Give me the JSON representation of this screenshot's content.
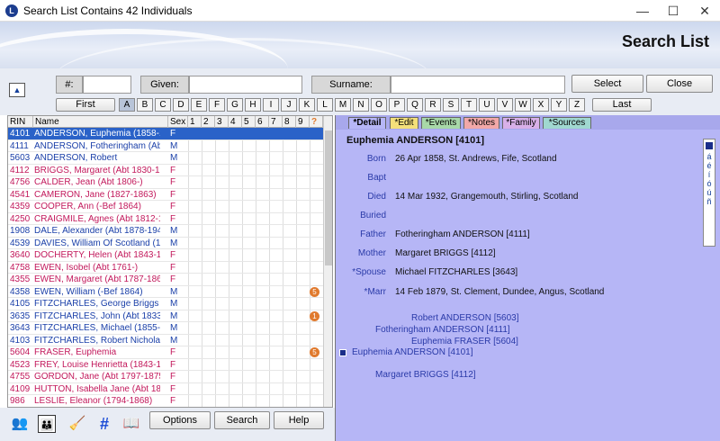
{
  "window": {
    "title": "Search List Contains 42 Individuals",
    "app_icon": "L"
  },
  "banner": {
    "title": "Search List"
  },
  "search": {
    "num_label": "#:",
    "given_label": "Given:",
    "surname_label": "Surname:",
    "select_label": "Select",
    "close_label": "Close",
    "first_label": "First",
    "last_label": "Last",
    "up_glyph": "▲"
  },
  "letters": [
    "A",
    "B",
    "C",
    "D",
    "E",
    "F",
    "G",
    "H",
    "I",
    "J",
    "K",
    "L",
    "M",
    "N",
    "O",
    "P",
    "Q",
    "R",
    "S",
    "T",
    "U",
    "V",
    "W",
    "X",
    "Y",
    "Z"
  ],
  "list": {
    "headers": {
      "rin": "RIN",
      "name": "Name",
      "sex": "Sex",
      "cols": [
        "1",
        "2",
        "3",
        "4",
        "5",
        "6",
        "7",
        "8",
        "9"
      ],
      "q": "?"
    },
    "rows": [
      {
        "rin": "4101",
        "name": "ANDERSON, Euphemia (1858-1",
        "sex": "F",
        "sel": true
      },
      {
        "rin": "4111",
        "name": "ANDERSON, Fotheringham (Ab",
        "sex": "M"
      },
      {
        "rin": "5603",
        "name": "ANDERSON, Robert",
        "sex": "M"
      },
      {
        "rin": "4112",
        "name": "BRIGGS, Margaret (Abt 1830-1",
        "sex": "F"
      },
      {
        "rin": "4756",
        "name": "CALDER, Jean (Abt 1806-)",
        "sex": "F"
      },
      {
        "rin": "4541",
        "name": "CAMERON, Jane (1827-1863)",
        "sex": "F"
      },
      {
        "rin": "4359",
        "name": "COOPER, Ann (-Bef 1864)",
        "sex": "F"
      },
      {
        "rin": "4250",
        "name": "CRAIGMILE, Agnes (Abt 1812-1",
        "sex": "F"
      },
      {
        "rin": "1908",
        "name": "DALE, Alexander (Abt 1878-194",
        "sex": "M"
      },
      {
        "rin": "4539",
        "name": "DAVIES, William Of Scotland (1",
        "sex": "M"
      },
      {
        "rin": "3640",
        "name": "DOCHERTY, Helen (Abt 1843-1",
        "sex": "F"
      },
      {
        "rin": "4758",
        "name": "EWEN, Isobel (Abt 1761-)",
        "sex": "F"
      },
      {
        "rin": "4355",
        "name": "EWEN, Margaret (Abt 1787-186",
        "sex": "F"
      },
      {
        "rin": "4358",
        "name": "EWEN, William (-Bef 1864)",
        "sex": "M",
        "badge": "5"
      },
      {
        "rin": "4105",
        "name": "FITZCHARLES, George Briggs",
        "sex": "M"
      },
      {
        "rin": "3635",
        "name": "FITZCHARLES, John (Abt 1833",
        "sex": "M",
        "badge": "1"
      },
      {
        "rin": "3643",
        "name": "FITZCHARLES, Michael (1855-1",
        "sex": "M"
      },
      {
        "rin": "4103",
        "name": "FITZCHARLES, Robert Nicholas",
        "sex": "M"
      },
      {
        "rin": "5604",
        "name": "FRASER, Euphemia",
        "sex": "F",
        "badge": "5"
      },
      {
        "rin": "4523",
        "name": "FREY, Louise Henrietta (1843-1",
        "sex": "F"
      },
      {
        "rin": "4755",
        "name": "GORDON, Jane (Abt 1797-1875",
        "sex": "F"
      },
      {
        "rin": "4109",
        "name": "HUTTON, Isabella Jane (Abt 186",
        "sex": "F"
      },
      {
        "rin": "986",
        "name": "LESLIE, Eleanor (1794-1868)",
        "sex": "F"
      }
    ]
  },
  "bottom": {
    "options_label": "Options",
    "search_label": "Search",
    "help_label": "Help"
  },
  "tabs": [
    "*Detail",
    "*Edit",
    "*Events",
    "*Notes",
    "*Family",
    "*Sources"
  ],
  "detail": {
    "heading": "Euphemia ANDERSON [4101]",
    "fields": [
      {
        "label": "Born",
        "value": "26 Apr 1858, St. Andrews, Fife, Scotland"
      },
      {
        "label": "Bapt",
        "value": ""
      },
      {
        "label": "Died",
        "value": "14 Mar 1932, Grangemouth, Stirling, Scotland"
      },
      {
        "label": "Buried",
        "value": ""
      },
      {
        "label": "Father",
        "value": "Fotheringham ANDERSON [4111]"
      },
      {
        "label": "Mother",
        "value": "Margaret BRIGGS [4112]"
      },
      {
        "label": "*Spouse",
        "value": "Michael FITZCHARLES [3643]"
      },
      {
        "label": "*Marr",
        "value": "14 Feb 1879, St. Clement, Dundee, Angus, Scotland"
      }
    ],
    "family": [
      "Robert ANDERSON [5603]",
      "Fotheringham ANDERSON [4111]",
      "Euphemia FRASER [5604]",
      "Euphemia ANDERSON [4101]",
      "Margaret BRIGGS [4112]"
    ],
    "accents": [
      "á",
      "é",
      "í",
      "ó",
      "ú",
      "ñ"
    ]
  }
}
